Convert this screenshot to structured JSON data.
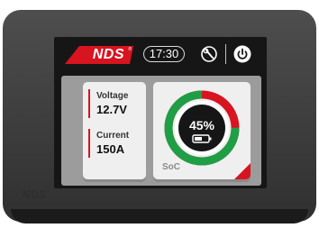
{
  "device": {
    "brand_mark": "NDS"
  },
  "topbar": {
    "logo": "NDS",
    "logo_reg": "®",
    "time": "17:30",
    "settings_icon": "gear-wrench-icon",
    "power_icon": "power-icon"
  },
  "metrics": {
    "voltage": {
      "label": "Voltage",
      "value": "12.7V"
    },
    "current": {
      "label": "Current",
      "value": "150A"
    }
  },
  "soc": {
    "label": "SoC",
    "percent": 45,
    "percent_text": "45%",
    "battery_icon": "battery-icon"
  },
  "colors": {
    "accent_red": "#d7141f",
    "gauge_green": "#1e9e45",
    "gauge_red": "#d7141f"
  }
}
